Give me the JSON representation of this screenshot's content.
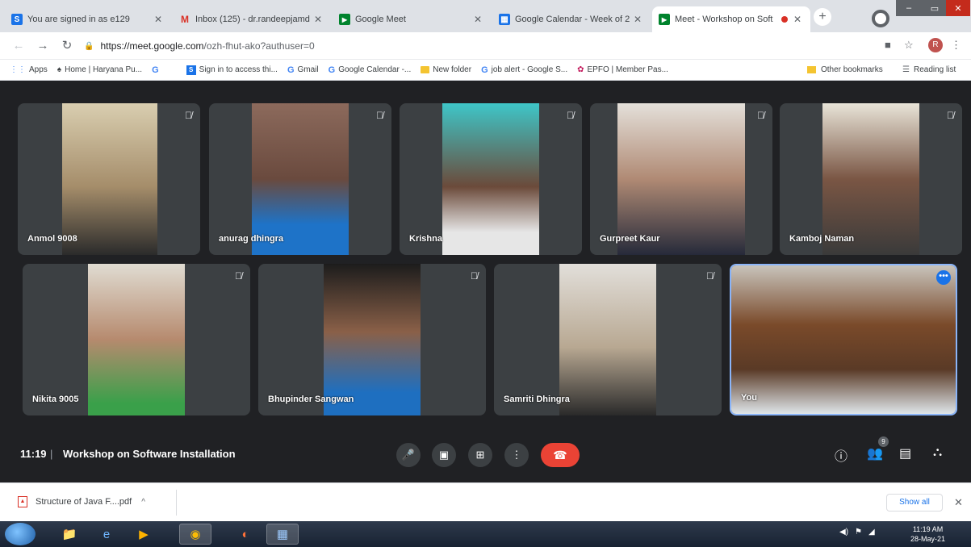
{
  "browser": {
    "tabs": [
      {
        "title": "You are signed in as e129",
        "favicon": "S",
        "favicon_color": "#1a73e8"
      },
      {
        "title": "Inbox (125) - dr.randeepjamd",
        "favicon": "M",
        "favicon_color": "#d93025"
      },
      {
        "title": "Google Meet",
        "favicon": "▶",
        "favicon_color": "#00832d"
      },
      {
        "title": "Google Calendar - Week of 2",
        "favicon": "▦",
        "favicon_color": "#1a73e8"
      },
      {
        "title": "Meet - Workshop on Soft",
        "favicon": "▶",
        "favicon_color": "#00832d",
        "active": true
      }
    ],
    "url_host": "https://meet.google.com",
    "url_path": "/ozh-fhut-ako?authuser=0",
    "profile_initial": "R",
    "bookmarks": [
      {
        "label": "Apps",
        "icon": "apps-icon"
      },
      {
        "label": "Home | Haryana Pu...",
        "icon": "emblem-icon"
      },
      {
        "label": "",
        "icon": "google-icon"
      },
      {
        "label": "Sign in to access thi...",
        "icon": "s-icon"
      },
      {
        "label": "Gmail",
        "icon": "google-icon"
      },
      {
        "label": "Google Calendar -...",
        "icon": "google-icon"
      },
      {
        "label": "New folder",
        "icon": "folder-icon"
      },
      {
        "label": "job alert - Google S...",
        "icon": "google-icon"
      },
      {
        "label": "EPFO | Member Pas...",
        "icon": "epfo-icon"
      }
    ],
    "other_bookmarks": "Other bookmarks",
    "reading_list": "Reading list"
  },
  "meet": {
    "participants_row1": [
      {
        "name": "Anmol 9008"
      },
      {
        "name": "anurag dhingra"
      },
      {
        "name": "Krishna"
      },
      {
        "name": "Gurpreet Kaur"
      },
      {
        "name": "Kamboj Naman"
      }
    ],
    "participants_row2": [
      {
        "name": "Nikita 9005"
      },
      {
        "name": "Bhupinder Sangwan"
      },
      {
        "name": "Samriti Dhingra"
      },
      {
        "name": "You"
      }
    ],
    "time": "11:19",
    "separator": "|",
    "title": "Workshop on Software Installation",
    "badge": "9"
  },
  "downloads": {
    "file": "Structure of Java F....pdf",
    "show_all": "Show all"
  },
  "taskbar": {
    "time": "11:19 AM",
    "date": "28-May-21"
  }
}
